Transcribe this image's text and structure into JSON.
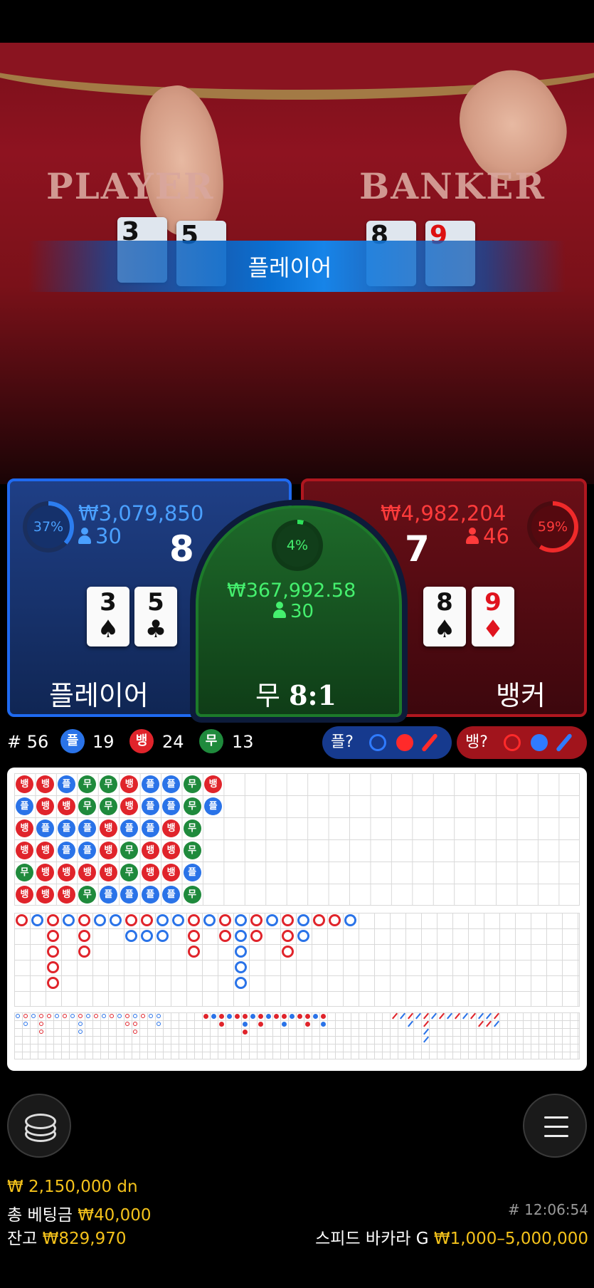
{
  "video": {
    "table_player_text": "PLAYER",
    "table_banker_text": "BANKER",
    "result_banner": "플레이어",
    "player_cards": [
      {
        "rank": "3",
        "suit": "♠",
        "red": false
      },
      {
        "rank": "5",
        "suit": "♣",
        "red": false
      }
    ],
    "banker_cards": [
      {
        "rank": "8",
        "suit": "♠",
        "red": false
      },
      {
        "rank": "9",
        "suit": "♦",
        "red": true
      }
    ]
  },
  "player": {
    "percent_label": "37%",
    "percent": 37,
    "amount": "₩3,079,850",
    "count": "30",
    "score": "8",
    "cards": [
      {
        "rank": "3",
        "suit": "♠"
      },
      {
        "rank": "5",
        "suit": "♣"
      }
    ],
    "label": "플레이어"
  },
  "banker": {
    "percent_label": "59%",
    "percent": 59,
    "amount": "₩4,982,204",
    "count": "46",
    "score": "7",
    "cards": [
      {
        "rank": "8",
        "suit": "♠"
      },
      {
        "rank": "9",
        "suit": "♦"
      }
    ],
    "label": "뱅커"
  },
  "tie": {
    "percent_label": "4%",
    "percent": 4,
    "amount": "₩367,992.58",
    "count": "30",
    "label": "무",
    "payout": "8:1"
  },
  "stats": {
    "shoe": "# 56",
    "player_badge": "플",
    "player_count": "19",
    "banker_badge": "뱅",
    "banker_count": "24",
    "tie_badge": "무",
    "tie_count": "13",
    "predict_player_label": "플?",
    "predict_banker_label": "뱅?"
  },
  "bead_road": [
    [
      "뱅",
      "플",
      "뱅",
      "뱅",
      "무",
      "뱅"
    ],
    [
      "뱅",
      "뱅",
      "플",
      "뱅",
      "뱅",
      "뱅"
    ],
    [
      "플",
      "뱅",
      "플",
      "플",
      "뱅",
      "뱅"
    ],
    [
      "무",
      "무",
      "플",
      "플",
      "뱅",
      "무"
    ],
    [
      "무",
      "무",
      "뱅",
      "뱅",
      "뱅",
      "플"
    ],
    [
      "뱅",
      "뱅",
      "플",
      "무",
      "무",
      "플"
    ],
    [
      "플",
      "플",
      "플",
      "뱅",
      "뱅",
      "플"
    ],
    [
      "플",
      "플",
      "뱅",
      "뱅",
      "뱅",
      "플"
    ],
    [
      "무",
      "무",
      "무",
      "무",
      "플",
      "무"
    ],
    [
      "뱅",
      "플",
      "",
      "",
      "",
      ""
    ]
  ],
  "colors": {
    "banker": "#e0242b",
    "player": "#2a73e8",
    "tie": "#1f8a3c",
    "gold": "#f4c21b"
  },
  "bottom": {
    "win_line": "₩ 2,150,000 dn",
    "total_bet_label": "총 베팅금",
    "total_bet": "₩40,000",
    "balance_label": "잔고",
    "balance": "₩829,970",
    "time": "# 12:06:54",
    "game_name": "스피드 바카라 G",
    "limits": "₩1,000–5,000,000",
    "chips_icon": "chip-stack-icon",
    "menu_icon": "hamburger-menu-icon"
  }
}
